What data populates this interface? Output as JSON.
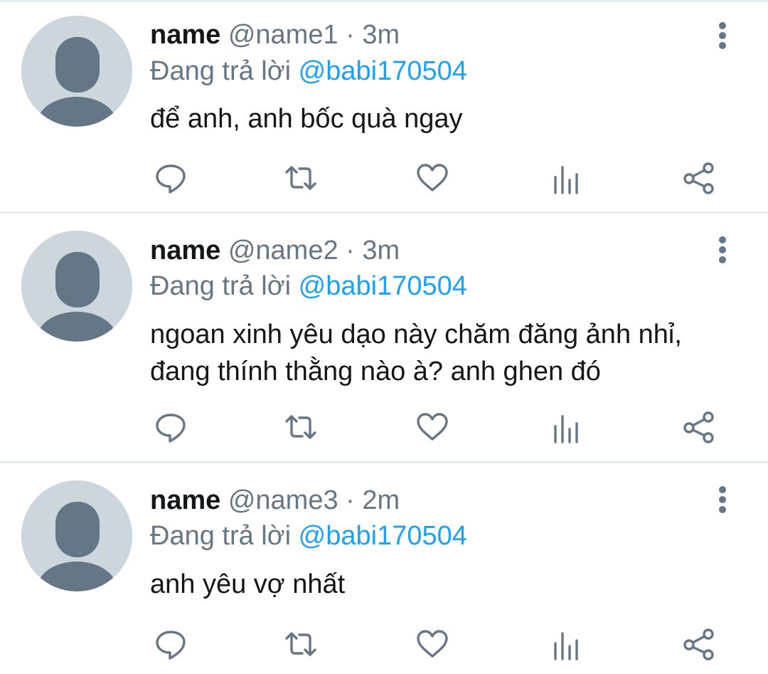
{
  "colors": {
    "mention": "#1da1f2",
    "secondary_text": "#657786",
    "primary_text": "#14171a",
    "divider": "#e6ecf0",
    "avatar_bg": "#ccd6dd",
    "avatar_fg": "#657786"
  },
  "action_icons": [
    "reply-icon",
    "retweet-icon",
    "like-icon",
    "analytics-icon",
    "share-icon"
  ],
  "replies": [
    {
      "name": "name",
      "handle": "@name1",
      "separator": "·",
      "time": "3m",
      "replying_prefix": "Đang trả lời",
      "replying_to": "@babi170504",
      "text_lines": [
        "để anh, anh bốc quà ngay"
      ]
    },
    {
      "name": "name",
      "handle": "@name2",
      "separator": "·",
      "time": "3m",
      "replying_prefix": "Đang trả lời",
      "replying_to": "@babi170504",
      "text_lines": [
        "ngoan xinh yêu dạo này chăm đăng ảnh nhỉ,",
        "đang thính thằng nào à? anh ghen đó"
      ]
    },
    {
      "name": "name",
      "handle": "@name3",
      "separator": "·",
      "time": "2m",
      "replying_prefix": "Đang trả lời",
      "replying_to": "@babi170504",
      "text_lines": [
        "anh yêu vợ nhất"
      ]
    }
  ]
}
